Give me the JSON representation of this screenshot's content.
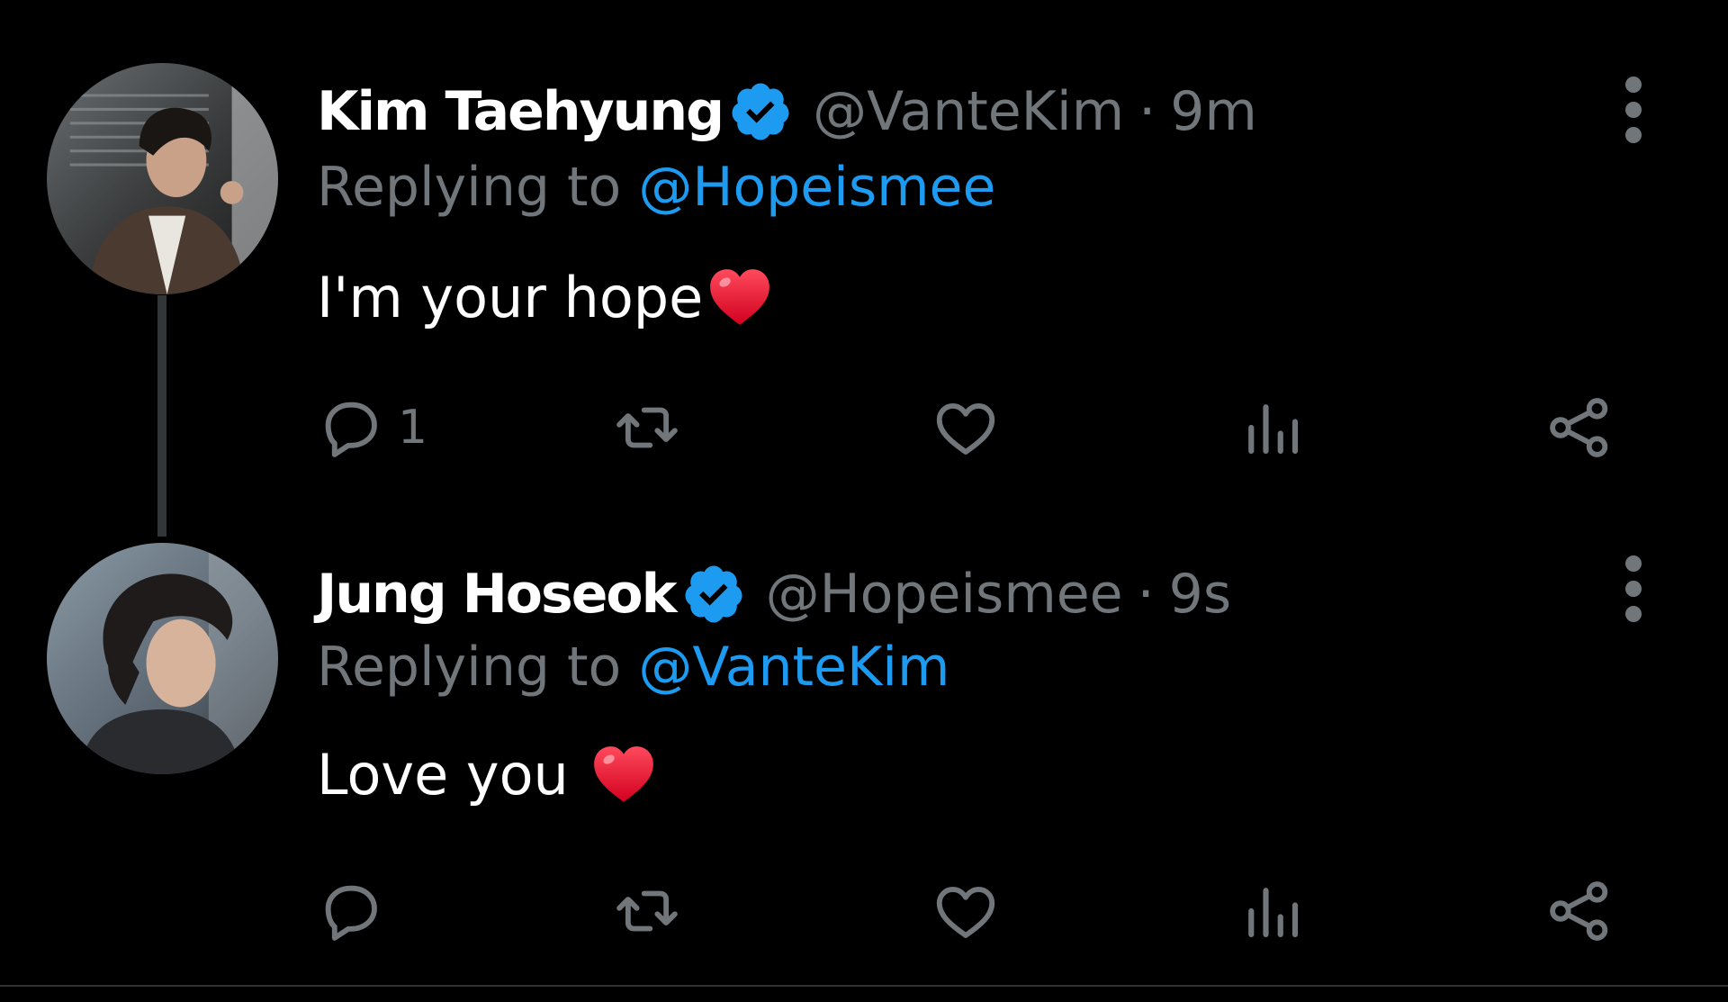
{
  "colors": {
    "background": "#000000",
    "name_text": "#ffffff",
    "secondary_text": "#71767b",
    "link": "#1d9bf0",
    "verified_badge": "#1d9bf0",
    "thread_line": "#333639",
    "heart_emoji": "#e0123a"
  },
  "tweets": [
    {
      "display_name": "Kim Taehyung",
      "handle": "@VanteKim",
      "separator": "·",
      "time": "9m",
      "reply_prefix": "Replying to ",
      "reply_to": "@Hopeismee",
      "text": "I'm your hope",
      "emoji": "red-heart",
      "avatar": "avatar-kim-taehyung",
      "actions": {
        "reply_count": "1",
        "retweet_count": "",
        "like_count": "",
        "icons": [
          "reply-icon",
          "retweet-icon",
          "like-icon",
          "views-icon",
          "share-icon"
        ]
      }
    },
    {
      "display_name": "Jung Hoseok",
      "handle": "@Hopeismee",
      "separator": "·",
      "time": "9s",
      "reply_prefix": "Replying to ",
      "reply_to": "@VanteKim",
      "text": "Love you ",
      "emoji": "red-heart",
      "avatar": "avatar-jung-hoseok",
      "actions": {
        "reply_count": "",
        "retweet_count": "",
        "like_count": "",
        "icons": [
          "reply-icon",
          "retweet-icon",
          "like-icon",
          "views-icon",
          "share-icon"
        ]
      }
    }
  ]
}
